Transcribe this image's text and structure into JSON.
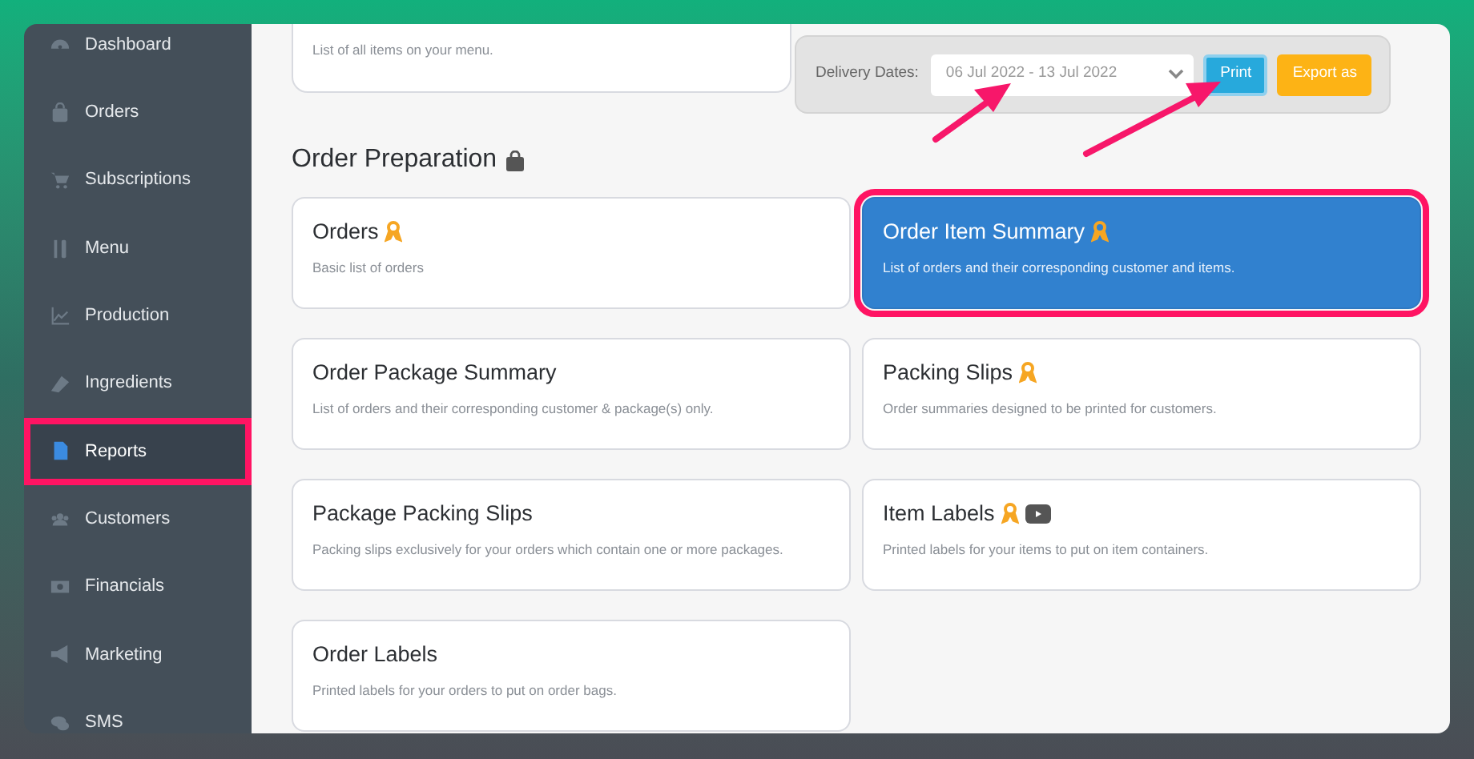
{
  "sidebar": {
    "items": [
      {
        "label": "Dashboard",
        "selected": false,
        "highlighted": false
      },
      {
        "label": "Orders",
        "selected": false,
        "highlighted": false
      },
      {
        "label": "Subscriptions",
        "selected": false,
        "highlighted": false
      },
      {
        "label": "Menu",
        "selected": false,
        "highlighted": false
      },
      {
        "label": "Production",
        "selected": false,
        "highlighted": false
      },
      {
        "label": "Ingredients",
        "selected": false,
        "highlighted": false
      },
      {
        "label": "Reports",
        "selected": true,
        "highlighted": true
      },
      {
        "label": "Customers",
        "selected": false,
        "highlighted": false
      },
      {
        "label": "Financials",
        "selected": false,
        "highlighted": false
      },
      {
        "label": "Marketing",
        "selected": false,
        "highlighted": false
      },
      {
        "label": "SMS",
        "selected": false,
        "highlighted": false
      }
    ]
  },
  "top_card": {
    "description": "List of all items on your menu."
  },
  "filter": {
    "label": "Delivery Dates:",
    "date_range": "06 Jul 2022 - 13 Jul 2022",
    "buttons": [
      {
        "label": "Print",
        "kind": "print"
      },
      {
        "label": "Export as",
        "kind": "export"
      }
    ]
  },
  "section": {
    "title": "Order Preparation",
    "cards": [
      {
        "title": "Orders",
        "description": "Basic list of orders",
        "ribbon": true,
        "video": false,
        "selected": false,
        "highlighted": false
      },
      {
        "title": "Order Item Summary",
        "description": "List of orders and their corresponding customer and items.",
        "ribbon": true,
        "video": false,
        "selected": true,
        "highlighted": true
      },
      {
        "title": "Order Package Summary",
        "description": "List of orders and their corresponding customer & package(s) only.",
        "ribbon": false,
        "video": false,
        "selected": false,
        "highlighted": false
      },
      {
        "title": "Packing Slips",
        "description": "Order summaries designed to be printed for customers.",
        "ribbon": true,
        "video": false,
        "selected": false,
        "highlighted": false
      },
      {
        "title": "Package Packing Slips",
        "description": "Packing slips exclusively for your orders which contain one or more packages.",
        "ribbon": false,
        "video": false,
        "selected": false,
        "highlighted": false
      },
      {
        "title": "Item Labels",
        "description": "Printed labels for your items to put on item containers.",
        "ribbon": true,
        "video": true,
        "selected": false,
        "highlighted": false
      },
      {
        "title": "Order Labels",
        "description": "Printed labels for your orders to put on order bags.",
        "ribbon": false,
        "video": false,
        "selected": false,
        "highlighted": false
      }
    ]
  }
}
